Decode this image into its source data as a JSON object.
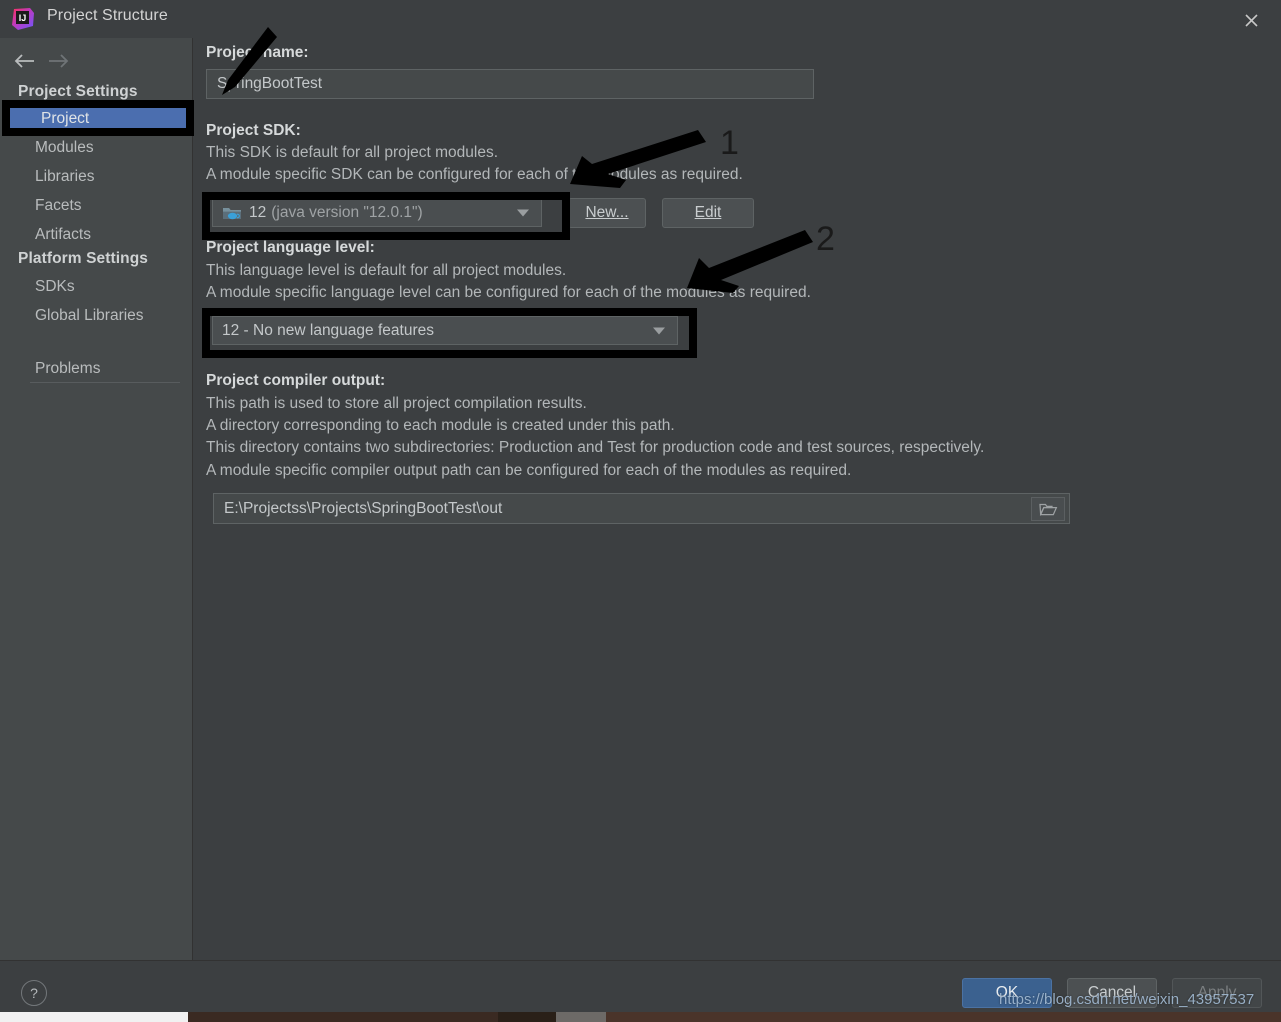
{
  "window": {
    "title": "Project Structure",
    "logo_icon": "intellij-idea-logo",
    "close_icon": "close-icon"
  },
  "nav": {
    "back_icon": "arrow-left-icon",
    "forward_icon": "arrow-right-icon"
  },
  "sidebar": {
    "groups": [
      {
        "label": "Project Settings"
      },
      {
        "label": "Platform Settings"
      }
    ],
    "items": [
      {
        "label": "Project",
        "selected": true
      },
      {
        "label": "Modules",
        "selected": false
      },
      {
        "label": "Libraries",
        "selected": false
      },
      {
        "label": "Facets",
        "selected": false
      },
      {
        "label": "Artifacts",
        "selected": false
      },
      {
        "label": "SDKs",
        "selected": false
      },
      {
        "label": "Global Libraries",
        "selected": false
      },
      {
        "label": "Problems",
        "selected": false
      }
    ]
  },
  "main": {
    "project_name": {
      "label": "Project name:",
      "value": "SpringBootTest"
    },
    "project_sdk": {
      "label": "Project SDK:",
      "desc_line1": "This SDK is default for all project modules.",
      "desc_line2": "A module specific SDK can be configured for each of the modules as required.",
      "selected_value": "12",
      "selected_detail": "(java version \"12.0.1\")",
      "sdk_icon": "java-sdk-folder-icon",
      "new_button": "New...",
      "new_button_mnemonic": "N",
      "edit_button": "Edit",
      "edit_button_mnemonic": "E"
    },
    "language_level": {
      "label": "Project language level:",
      "desc_line1": "This language level is default for all project modules.",
      "desc_line2": "A module specific language level can be configured for each of the modules as required.",
      "selected_value": "12 - No new language features"
    },
    "compiler_output": {
      "label": "Project compiler output:",
      "desc_line1": "This path is used to store all project compilation results.",
      "desc_line2": "A directory corresponding to each module is created under this path.",
      "desc_line3": "This directory contains two subdirectories: Production and Test for production code and test sources, respectively.",
      "desc_line4": "A module specific compiler output path can be configured for each of the modules as required.",
      "value": "E:\\Projectss\\Projects\\SpringBootTest\\out",
      "browse_icon": "folder-browse-icon"
    }
  },
  "footer": {
    "help_icon": "help-question-icon",
    "ok_button": "OK",
    "cancel_button": "Cancel",
    "apply_button": "Apply",
    "watermark": "https://blog.csdn.net/weixin_43957537"
  },
  "annotations": {
    "number_1": "1",
    "number_2": "2"
  },
  "colors": {
    "dialog_bg": "#3c3f41",
    "sidebar_bg": "#45494a",
    "selection_blue": "#4b6eaf",
    "ok_button_blue": "#3b618f",
    "annotation_black": "#000000",
    "text_primary": "#d6d9da",
    "text_secondary": "#b3b7b9"
  }
}
